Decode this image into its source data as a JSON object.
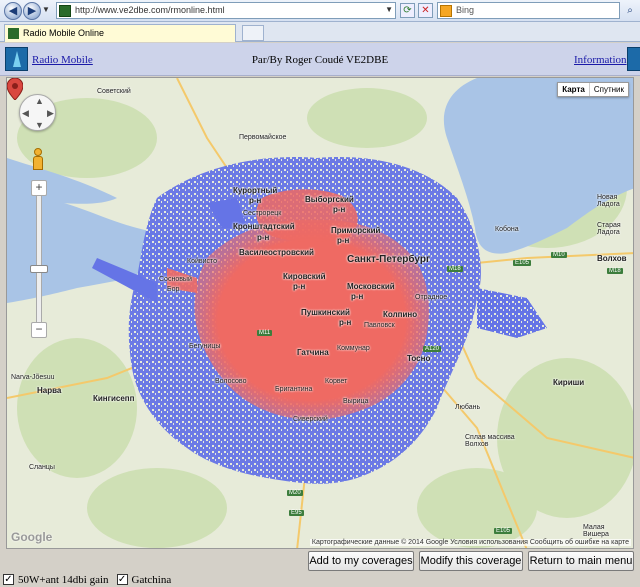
{
  "browser": {
    "url": "http://www.ve2dbe.com/rmonline.html",
    "search_placeholder": "Bing",
    "tab_title": "Radio Mobile Online"
  },
  "header": {
    "left_link": "Radio Mobile",
    "title": "Par/By Roger Coudé VE2DBE",
    "right_link": "Information"
  },
  "map": {
    "type_buttons": [
      "Карта",
      "Спутник"
    ],
    "attribution": "Картографические данные © 2014 Google   Условия использования   Сообщить об ошибке на карте",
    "google_logo": "Google",
    "labels": {
      "sovetsky": "Советский",
      "pervomayskoe": "Первомайское",
      "kurortny": "Курортный",
      "kurortny_rn": "р-н",
      "vyborgsky": "Выборгский",
      "vyborgsky_rn": "р-н",
      "sestroretsk": "Сестрорецк",
      "kronshtadt": "Кронштадтский",
      "kronshtadt_rn": "р-н",
      "primorsky": "Приморский",
      "primorsky_rn": "р-н",
      "vasileostrovsky": "Василеостровский",
      "saint_petersburg": "Санкт-Петербург",
      "kirovsky": "Кировский",
      "kirovsky_rn": "р-н",
      "moskovsky": "Московский",
      "moskovsky_rn": "р-н",
      "koyvisto": "Койвисто",
      "sosnovy_bor": "Сосновый",
      "bor": "Бор",
      "pushkinsky": "Пушкинский",
      "pushkinsky_rn": "р-н",
      "kolpino": "Колпино",
      "pavlovsk": "Павловск",
      "gatchina": "Гатчина",
      "kommunar": "Коммунар",
      "tosno": "Тосно",
      "volosovo": "Волосово",
      "begunitsy": "Бегуницы",
      "korvet": "Корвет",
      "siverskiy": "Сиверский",
      "vyritsa": "Вырица",
      "lyuban": "Любань",
      "narva_joesuu": "Narva-Jõesuu",
      "narva": "Нарва",
      "kingisepp": "Кингисепп",
      "slantsy": "Сланцы",
      "kirishi": "Кириши",
      "kobona": "Кобона",
      "staraya_ladoga": "Старая\nЛадога",
      "novaya_ladoga": "Новая\nЛадога",
      "volkhov": "Волхов",
      "otradnoe": "Отрадное",
      "splav_massiva": "Сплав массива\nВолхов",
      "malaya_vishera": "Малая\nВишера",
      "brigantina": "Бригантина"
    },
    "shields": [
      "M18",
      "E105",
      "M10",
      "M11",
      "M20",
      "E95",
      "A120",
      "M18",
      "E105"
    ]
  },
  "actions": {
    "add": "Add to my coverages",
    "modify": "Modify this coverage",
    "return": "Return to main menu"
  },
  "coverages": [
    {
      "label": "50W+ant 14dbi gain",
      "checked": true
    },
    {
      "label": "Gatchina",
      "checked": true
    }
  ],
  "colors": {
    "coverage_strong": "#ef6a63",
    "coverage_weak": "#6574e6",
    "water": "#a9c4e6",
    "land": "#e7ebd9"
  }
}
